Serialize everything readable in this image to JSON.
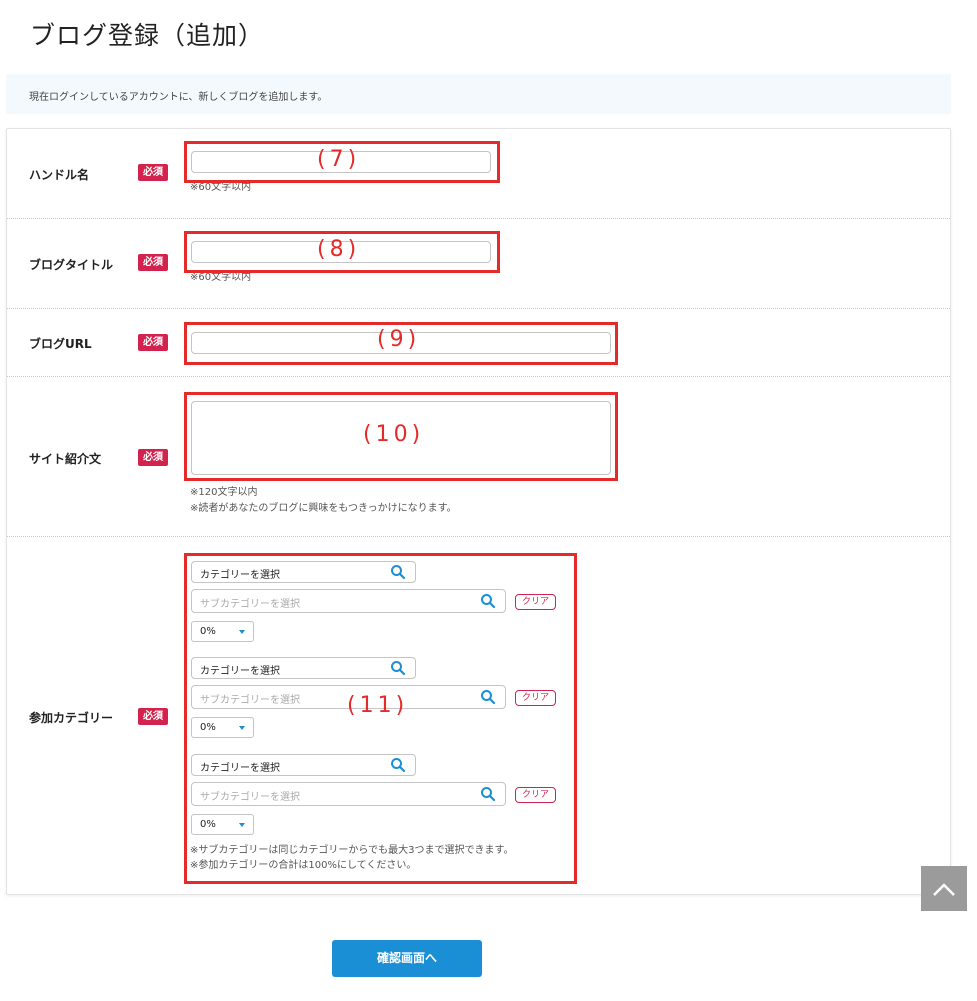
{
  "page": {
    "title": "ブログ登録（追加）",
    "intro": "現在ログインしているアカウントに、新しくブログを追加します。"
  },
  "required_badge": "必須",
  "fields": {
    "handle": {
      "label": "ハンドル名",
      "value": "",
      "hint": "※60文字以内",
      "annotation": "(7)"
    },
    "blog_title": {
      "label": "ブログタイトル",
      "value": "",
      "hint": "※60文字以内",
      "annotation": "(8)"
    },
    "blog_url": {
      "label": "ブログURL",
      "value": "",
      "annotation": "(9)"
    },
    "site_intro": {
      "label": "サイト紹介文",
      "value": "",
      "hint1": "※120文字以内",
      "hint2": "※読者があなたのブログに興味をもつきっかけになります。",
      "annotation": "(10)"
    },
    "categories": {
      "label": "参加カテゴリー",
      "annotation": "(11)",
      "groups": [
        {
          "category": "カテゴリーを選択",
          "subcategory_placeholder": "サブカテゴリーを選択",
          "clear_label": "クリア",
          "percent": "0%"
        },
        {
          "category": "カテゴリーを選択",
          "subcategory_placeholder": "サブカテゴリーを選択",
          "clear_label": "クリア",
          "percent": "0%"
        },
        {
          "category": "カテゴリーを選択",
          "subcategory_placeholder": "サブカテゴリーを選択",
          "clear_label": "クリア",
          "percent": "0%"
        }
      ],
      "note1": "※サブカテゴリーは同じカテゴリーからでも最大3つまで選択できます。",
      "note2": "※参加カテゴリーの合計は100%にしてください。"
    }
  },
  "submit_label": "確認画面へ",
  "colors": {
    "required": "#d4224f",
    "annotation": "#e52a2a",
    "primary": "#1b8fd6",
    "intro_bg": "#f3f9fd"
  }
}
